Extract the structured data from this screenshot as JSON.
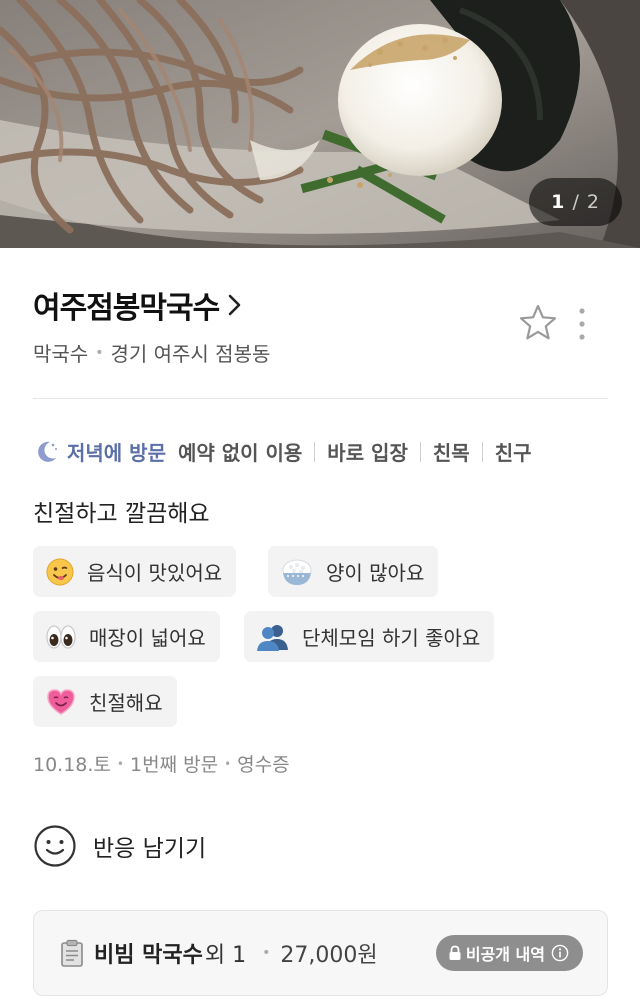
{
  "hero": {
    "photo_icon": "noodle-photo",
    "counter_current": "1",
    "counter_separator": "/",
    "counter_total": "2"
  },
  "place": {
    "name": "여주점봉막국수",
    "category": "막국수",
    "location": "경기 여주시 점봉동"
  },
  "visit": {
    "time": "저녁에 방문",
    "tags": [
      "예약 없이 이용",
      "바로 입장",
      "친목",
      "친구"
    ]
  },
  "review_text": "친절하고 깔끔해요",
  "keywords": [
    {
      "icon": "smiley-icon",
      "label": "음식이 맛있어요"
    },
    {
      "icon": "rice-bowl-icon",
      "label": "양이 많아요"
    },
    {
      "icon": "eyes-icon",
      "label": "매장이 넓어요"
    },
    {
      "icon": "people-icon",
      "label": "단체모임 하기 좋아요"
    },
    {
      "icon": "heart-icon",
      "label": "친절해요"
    }
  ],
  "meta": {
    "date": "10.18.토",
    "visit_count": "1번째 방문",
    "proof": "영수증"
  },
  "reaction_label": "반응 남기기",
  "order": {
    "menu": "비빔 막국수",
    "extra": "외 1",
    "price": "27,000원",
    "private_label": "비공개 내역"
  },
  "colors": {
    "visit_accent": "#5b6fa8",
    "chip_bg": "#f3f3f3",
    "badge_bg": "#8e8e8e"
  }
}
